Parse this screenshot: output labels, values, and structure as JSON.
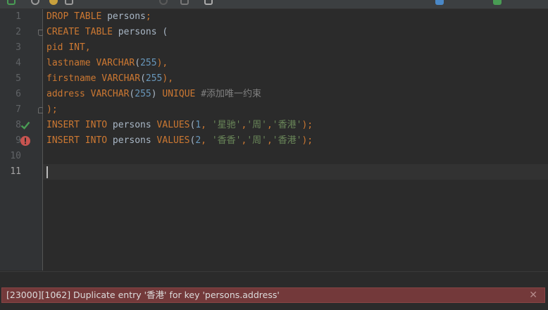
{
  "editor": {
    "line_numbers": [
      "1",
      "2",
      "3",
      "4",
      "5",
      "6",
      "7",
      "8",
      "9",
      "10",
      "11"
    ],
    "lines": [
      [
        {
          "t": "DROP TABLE ",
          "c": "kw"
        },
        {
          "t": "persons",
          "c": "id"
        },
        {
          "t": ";",
          "c": "kw"
        }
      ],
      [
        {
          "t": "CREATE TABLE ",
          "c": "kw"
        },
        {
          "t": "persons (",
          "c": "id"
        }
      ],
      [
        {
          "t": "pid ",
          "c": "kw"
        },
        {
          "t": "INT",
          "c": "kw"
        },
        {
          "t": ",",
          "c": "kw"
        }
      ],
      [
        {
          "t": "lastname ",
          "c": "kw"
        },
        {
          "t": "VARCHAR",
          "c": "kw"
        },
        {
          "t": "(",
          "c": "id"
        },
        {
          "t": "255",
          "c": "num"
        },
        {
          "t": "),",
          "c": "kw"
        }
      ],
      [
        {
          "t": "firstname ",
          "c": "kw"
        },
        {
          "t": "VARCHAR",
          "c": "kw"
        },
        {
          "t": "(",
          "c": "id"
        },
        {
          "t": "255",
          "c": "num"
        },
        {
          "t": "),",
          "c": "kw"
        }
      ],
      [
        {
          "t": "address ",
          "c": "kw"
        },
        {
          "t": "VARCHAR",
          "c": "kw"
        },
        {
          "t": "(",
          "c": "id"
        },
        {
          "t": "255",
          "c": "num"
        },
        {
          "t": ") ",
          "c": "id"
        },
        {
          "t": "UNIQUE ",
          "c": "kw"
        },
        {
          "t": "#添加唯一约束",
          "c": "cmt"
        }
      ],
      [
        {
          "t": ");",
          "c": "kw"
        }
      ],
      [
        {
          "t": "INSERT INTO ",
          "c": "kw"
        },
        {
          "t": "persons ",
          "c": "id"
        },
        {
          "t": "VALUES",
          "c": "kw"
        },
        {
          "t": "(",
          "c": "id"
        },
        {
          "t": "1",
          "c": "num"
        },
        {
          "t": ", ",
          "c": "kw"
        },
        {
          "t": "'星驰'",
          "c": "str"
        },
        {
          "t": ",",
          "c": "kw"
        },
        {
          "t": "'周'",
          "c": "str"
        },
        {
          "t": ",",
          "c": "kw"
        },
        {
          "t": "'香港'",
          "c": "str"
        },
        {
          "t": ");",
          "c": "kw"
        }
      ],
      [
        {
          "t": "INSERT INTO ",
          "c": "kw"
        },
        {
          "t": "persons ",
          "c": "id"
        },
        {
          "t": "VALUES",
          "c": "kw"
        },
        {
          "t": "(",
          "c": "id"
        },
        {
          "t": "2",
          "c": "num"
        },
        {
          "t": ", ",
          "c": "kw"
        },
        {
          "t": "'香香'",
          "c": "str"
        },
        {
          "t": ",",
          "c": "kw"
        },
        {
          "t": "'周'",
          "c": "str"
        },
        {
          "t": ",",
          "c": "kw"
        },
        {
          "t": "'香港'",
          "c": "str"
        },
        {
          "t": ");",
          "c": "kw"
        }
      ],
      [],
      []
    ],
    "current_line": 11
  },
  "status": {
    "error_message": "[23000][1062] Duplicate entry '香港' for key 'persons.address'",
    "close_glyph": "✕"
  },
  "colors": {
    "keyword": "#cc7832",
    "number": "#6897bb",
    "string": "#6a8759",
    "comment": "#808080",
    "error_bg": "#73393a"
  }
}
